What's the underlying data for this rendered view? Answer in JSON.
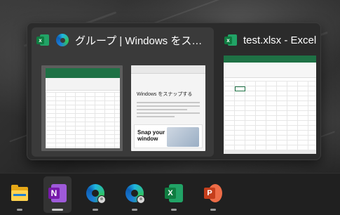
{
  "switcher": {
    "group": {
      "title": "グループ | Windows をスナップする - 個人用 - Microsoft Edge",
      "apps": [
        "excel-icon",
        "edge-icon"
      ],
      "edge_page": {
        "heading": "Windows をスナップする",
        "promo_line1": "Snap your",
        "promo_line2": "window"
      }
    },
    "window2": {
      "title": "test.xlsx - Excel",
      "app": "excel-icon"
    }
  },
  "taskbar": {
    "items": [
      {
        "name": "file-explorer",
        "icon": "folder-icon",
        "running": true,
        "active": false
      },
      {
        "name": "onenote",
        "icon": "onenote-icon",
        "label": "N",
        "running": true,
        "active": true
      },
      {
        "name": "edge-profile-1",
        "icon": "edge-icon",
        "running": true,
        "active": false
      },
      {
        "name": "edge-profile-2",
        "icon": "edge-icon",
        "running": true,
        "active": false
      },
      {
        "name": "excel",
        "icon": "excel-icon",
        "label": "X",
        "running": true,
        "active": false
      },
      {
        "name": "powerpoint",
        "icon": "powerpoint-icon",
        "label": "P",
        "running": true,
        "active": false
      }
    ]
  },
  "colors": {
    "excel": "#107c41",
    "onenote": "#7719aa",
    "powerpoint": "#c43e1c",
    "taskbar": "#202020",
    "switcher": "#2b2b2b"
  }
}
